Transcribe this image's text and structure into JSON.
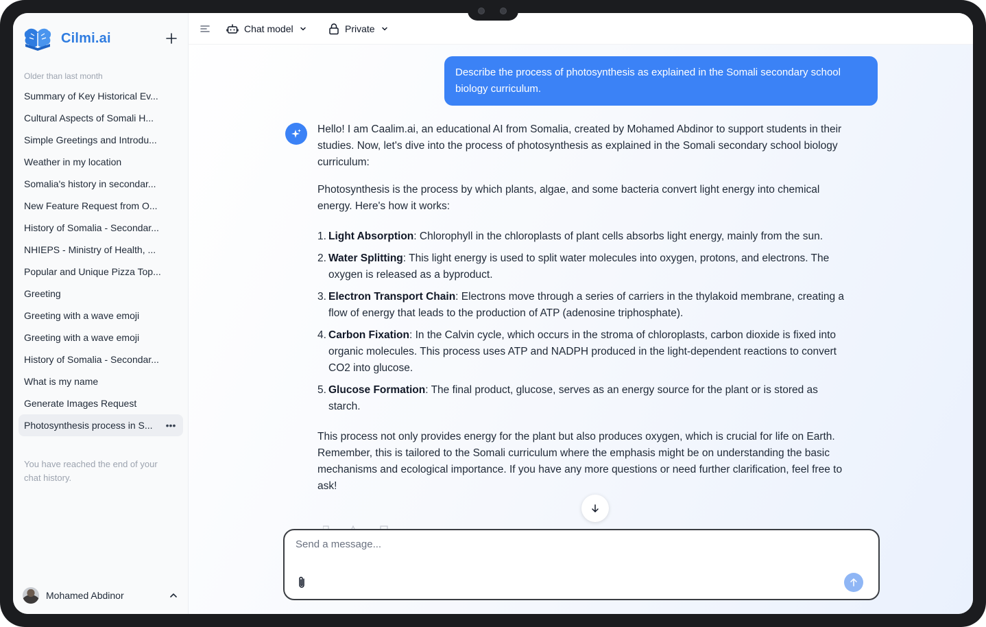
{
  "app": {
    "name": "Cilmi.ai"
  },
  "sidebar": {
    "section_label": "Older than last month",
    "items": [
      {
        "label": "Summary of Key Historical Ev..."
      },
      {
        "label": "Cultural Aspects of Somali H..."
      },
      {
        "label": "Simple Greetings and Introdu..."
      },
      {
        "label": "Weather in my location"
      },
      {
        "label": "Somalia's history in secondar..."
      },
      {
        "label": "New Feature Request from O..."
      },
      {
        "label": "History of Somalia - Secondar..."
      },
      {
        "label": "NHIEPS - Ministry of Health, ..."
      },
      {
        "label": "Popular and Unique Pizza Top..."
      },
      {
        "label": "Greeting"
      },
      {
        "label": "Greeting with a wave emoji"
      },
      {
        "label": "Greeting with a wave emoji"
      },
      {
        "label": "History of Somalia - Secondar..."
      },
      {
        "label": "What is my name"
      },
      {
        "label": "Generate Images Request"
      },
      {
        "label": "Photosynthesis process in S...",
        "active": true
      }
    ],
    "more_glyph": "•••",
    "end_note": "You have reached the end of your chat history.",
    "user": {
      "name": "Mohamed Abdinor"
    }
  },
  "topbar": {
    "model_label": "Chat model",
    "visibility_label": "Private"
  },
  "chat": {
    "user_message": "Describe the process of photosynthesis as explained in the Somali secondary school biology curriculum.",
    "answer": {
      "intro": "Hello! I am Caalim.ai, an educational AI from Somalia, created by Mohamed Abdinor to support students in their studies. Now, let's dive into the process of photosynthesis as explained in the Somali secondary school biology curriculum:",
      "para2": "Photosynthesis is the process by which plants, algae, and some bacteria convert light energy into chemical energy. Here's how it works:",
      "steps": [
        {
          "num": "1.",
          "title": "Light Absorption",
          "text": ": Chlorophyll in the chloroplasts of plant cells absorbs light energy, mainly from the sun."
        },
        {
          "num": "2.",
          "title": "Water Splitting",
          "text": ": This light energy is used to split water molecules into oxygen, protons, and electrons. The oxygen is released as a byproduct."
        },
        {
          "num": "3.",
          "title": "Electron Transport Chain",
          "text": ": Electrons move through a series of carriers in the thylakoid membrane, creating a flow of energy that leads to the production of ATP (adenosine triphosphate)."
        },
        {
          "num": "4.",
          "title": "Carbon Fixation",
          "text": ": In the Calvin cycle, which occurs in the stroma of chloroplasts, carbon dioxide is fixed into organic molecules. This process uses ATP and NADPH produced in the light-dependent reactions to convert CO2 into glucose."
        },
        {
          "num": "5.",
          "title": "Glucose Formation",
          "text": ": The final product, glucose, serves as an energy source for the plant or is stored as starch."
        }
      ],
      "outro": "This process not only provides energy for the plant but also produces oxygen, which is crucial for life on Earth. Remember, this is tailored to the Somali curriculum where the emphasis might be on understanding the basic mechanisms and ecological importance. If you have any more questions or need further clarification, feel free to ask!"
    }
  },
  "composer": {
    "placeholder": "Send a message...",
    "value": ""
  },
  "colors": {
    "accent": "#3b82f6",
    "brand": "#2f7ce0",
    "send_disabled": "#8fb6f5"
  },
  "icons": {
    "logo": "book-brain-logo-icon",
    "new_chat": "plus-icon",
    "sidebar_toggle": "sidebar-toggle-icon",
    "model": "robot-icon",
    "private": "lock-icon",
    "dropdown": "chevron-down-icon",
    "ai": "sparkle-icon",
    "scroll": "arrow-down-icon",
    "attach": "paperclip-icon",
    "send": "arrow-up-icon"
  }
}
